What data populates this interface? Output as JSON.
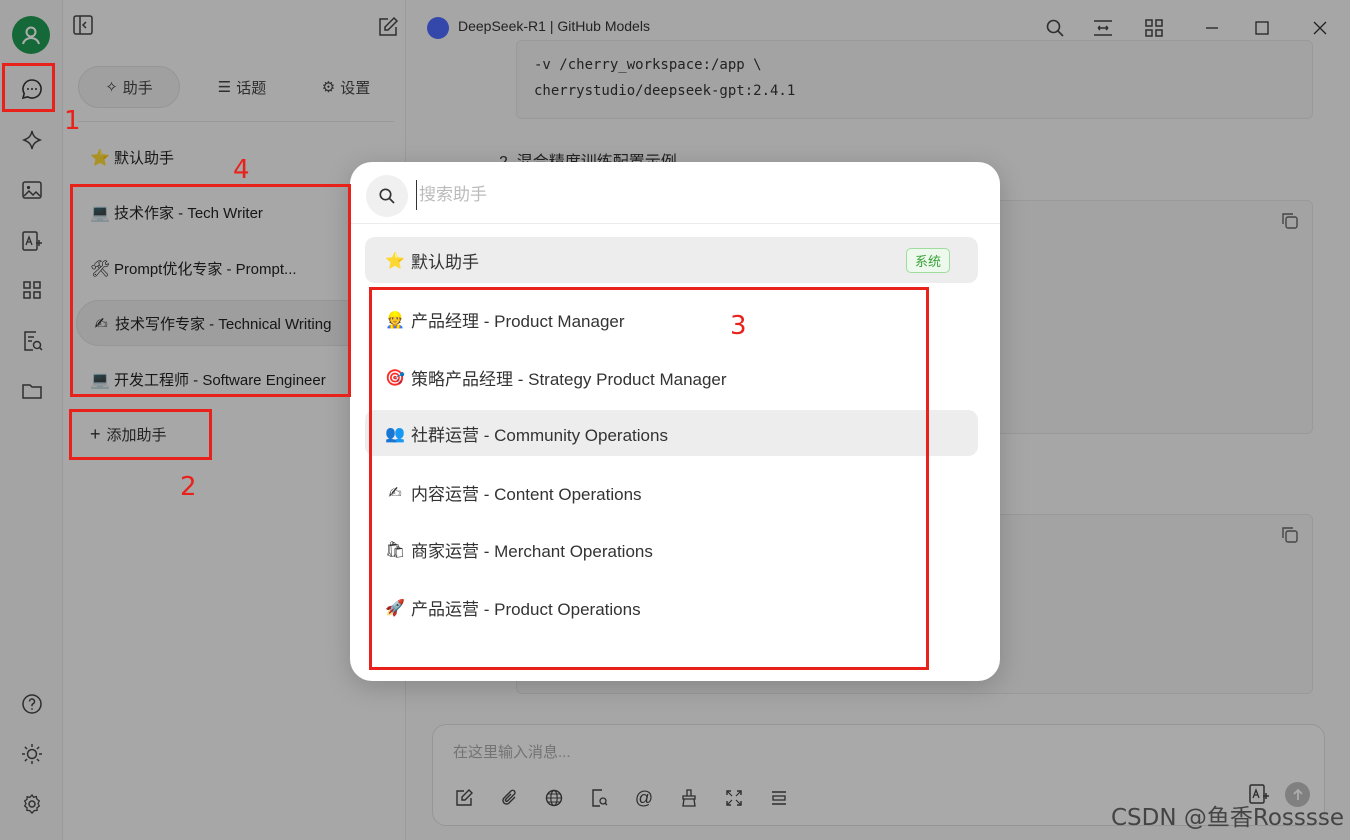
{
  "window": {
    "title": "DeepSeek-R1 | GitHub Models"
  },
  "panel": {
    "tabs": [
      {
        "icon": "✧",
        "label": "助手"
      },
      {
        "icon": "☰",
        "label": "话题"
      },
      {
        "icon": "⚙",
        "label": "设置"
      }
    ],
    "assistants": [
      {
        "emoji": "⭐",
        "label": "默认助手"
      },
      {
        "emoji": "💻",
        "label": "技术作家 - Tech Writer"
      },
      {
        "emoji": "🛠",
        "label": "Prompt优化专家 - Prompt..."
      },
      {
        "emoji": "✍",
        "label": "技术写作专家 - Technical Writing"
      },
      {
        "emoji": "💻",
        "label": "开发工程师 - Software Engineer"
      }
    ],
    "add_label": "添加助手"
  },
  "main": {
    "code1_line1": "-v /cherry_workspace:/app \\",
    "code1_line2": "cherrystudio/deepseek-gpt:2.4.1",
    "section_title": "2. 混合精度训练配置示例",
    "input_placeholder": "在这里输入消息..."
  },
  "modal": {
    "search_placeholder": "搜索助手",
    "default_item": {
      "emoji": "⭐",
      "label": "默认助手",
      "badge": "系统"
    },
    "items": [
      {
        "emoji": "👷",
        "label": "产品经理 - Product Manager"
      },
      {
        "emoji": "🎯",
        "label": "策略产品经理 - Strategy Product Manager"
      },
      {
        "emoji": "👥",
        "label": "社群运营 - Community Operations"
      },
      {
        "emoji": "✍",
        "label": "内容运营 - Content Operations"
      },
      {
        "emoji": "🛍",
        "label": "商家运营 - Merchant Operations"
      },
      {
        "emoji": "🚀",
        "label": "产品运营 - Product Operations"
      }
    ]
  },
  "annotations": [
    "1",
    "2",
    "3",
    "4"
  ],
  "watermark": "CSDN @鱼香Rosssse",
  "colors": {
    "accent_green": "#1f9a52",
    "annotation_red": "#e8221b",
    "badge_green": "#39a239"
  }
}
